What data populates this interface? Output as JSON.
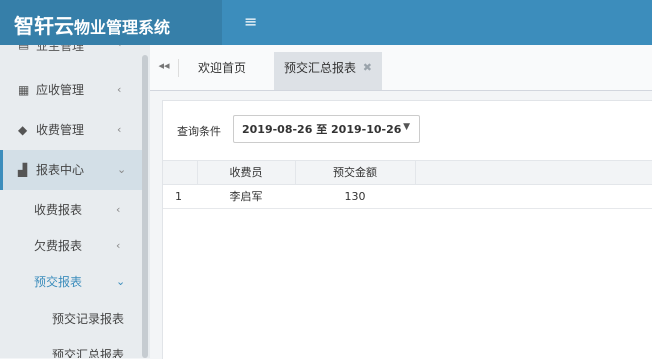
{
  "header": {
    "logo_main": "智轩云",
    "logo_sub": "物业管理系统",
    "menu_toggle_icon": "hamburger-icon"
  },
  "sidebar": {
    "partial_item": "业主管理",
    "items": [
      {
        "label": "应收管理",
        "icon": "grid-icon"
      },
      {
        "label": "收费管理",
        "icon": "tag-icon"
      },
      {
        "label": "报表中心",
        "icon": "area-chart-icon"
      }
    ],
    "sub_items": [
      {
        "label": "收费报表"
      },
      {
        "label": "欠费报表"
      },
      {
        "label": "预交报表"
      }
    ],
    "subsub_items": [
      {
        "label": "预交记录报表"
      },
      {
        "label": "预交汇总报表"
      }
    ]
  },
  "tabs": {
    "home": "欢迎首页",
    "current": "预交汇总报表"
  },
  "query": {
    "label": "查询条件",
    "date_range": "2019-08-26 至 2019-10-26"
  },
  "table": {
    "headers": [
      "收费员",
      "预交金额"
    ],
    "rows": [
      {
        "index": "1",
        "collector": "李启军",
        "amount": "130"
      }
    ]
  },
  "colors": {
    "accent": "#3c8dbc",
    "header": "#3c8dbc",
    "logo_bg": "#367fa9"
  }
}
